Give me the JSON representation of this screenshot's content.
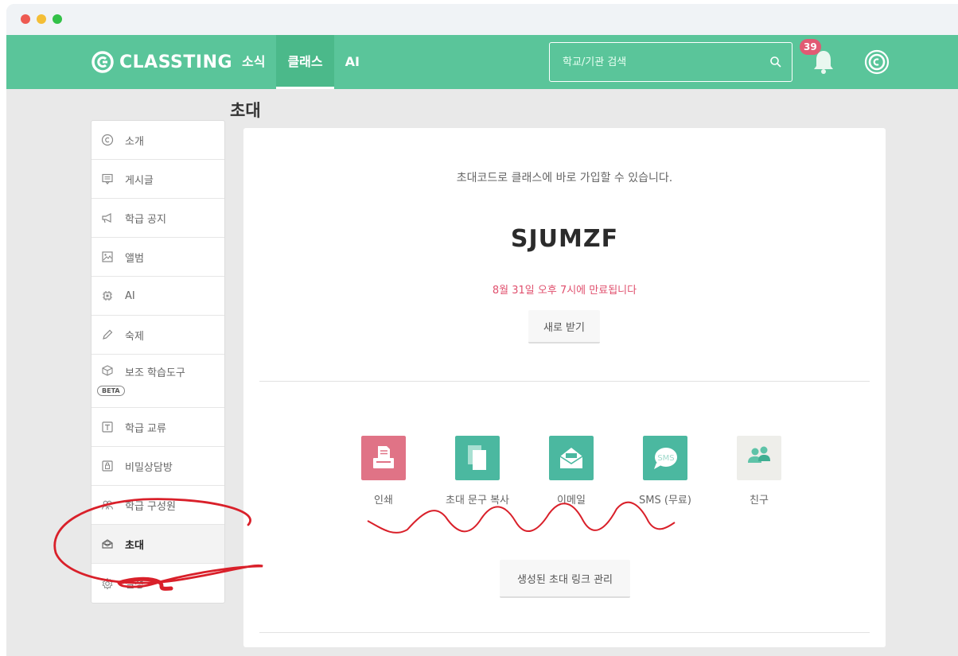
{
  "window": {
    "title": ""
  },
  "header": {
    "logo_text": "CLASSTING",
    "nav": [
      {
        "label": "소식"
      },
      {
        "label": "클래스"
      },
      {
        "label": "AI"
      }
    ],
    "active_nav": "클래스",
    "search_placeholder": "학교/기관 검색",
    "notification_count": "39",
    "brand_color": "#5ac59a"
  },
  "page": {
    "title": "초대"
  },
  "sidebar": {
    "items": [
      {
        "label": "소개",
        "icon": "copyright-icon"
      },
      {
        "label": "게시글",
        "icon": "board-icon"
      },
      {
        "label": "학급 공지",
        "icon": "megaphone-icon"
      },
      {
        "label": "앨범",
        "icon": "album-icon"
      },
      {
        "label": "AI",
        "icon": "chip-icon"
      },
      {
        "label": "숙제",
        "icon": "pencil-icon"
      },
      {
        "label": "보조 학습도구",
        "icon": "cube-icon",
        "badge": "BETA"
      },
      {
        "label": "학급 교류",
        "icon": "exchange-icon"
      },
      {
        "label": "비밀상담방",
        "icon": "lock-chat-icon"
      },
      {
        "label": "학급 구성원",
        "icon": "members-icon"
      },
      {
        "label": "초대",
        "icon": "invite-icon",
        "active": true
      },
      {
        "label": "설정",
        "icon": "gear-icon"
      }
    ]
  },
  "invite": {
    "description": "초대코드로 클래스에 바로 가입할 수 있습니다.",
    "code": "SJUMZF",
    "expiry": "8월 31일 오후 7시에 만료됩니다",
    "refresh_label": "새로 받기",
    "options": [
      {
        "label": "인쇄",
        "icon": "print-icon",
        "color": "#e07386"
      },
      {
        "label": "초대 문구 복사",
        "icon": "copy-icon",
        "color": "#4bb8a0"
      },
      {
        "label": "이메일",
        "icon": "email-icon",
        "color": "#4bb8a0"
      },
      {
        "label": "SMS (무료)",
        "icon": "sms-icon",
        "color": "#4bb8a0"
      },
      {
        "label": "친구",
        "icon": "friends-icon",
        "color": "#eeeeea"
      }
    ],
    "manage_label": "생성된 초대 링크 관리"
  },
  "annotation_color": "#d9202a"
}
